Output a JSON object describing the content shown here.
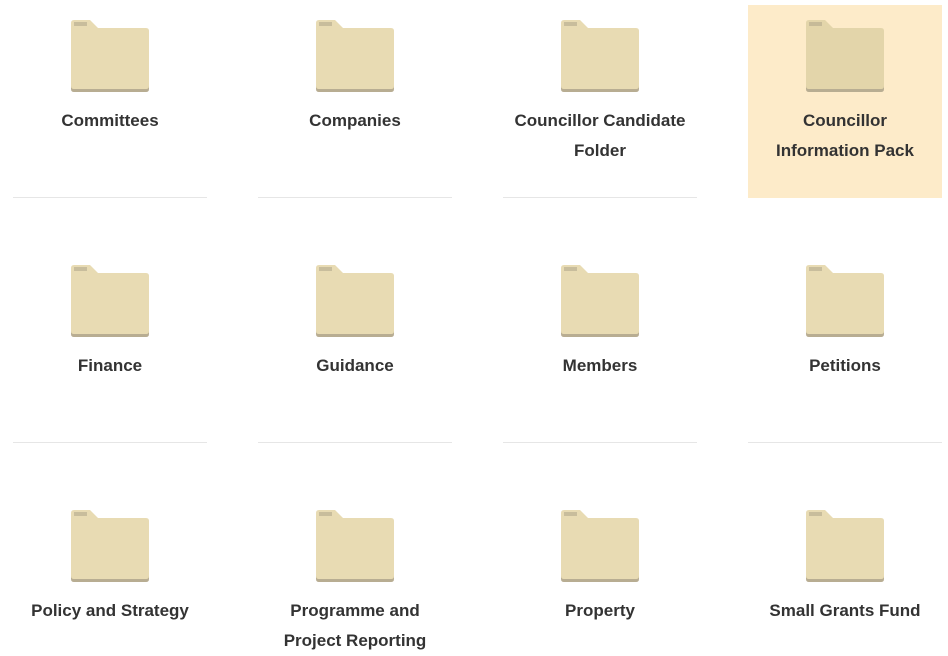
{
  "colors": {
    "folder_fill": "#e8dbb3",
    "folder_tab": "#e3d5aa",
    "folder_shadow": "#b8ad92",
    "highlight_bg": "#fdebc9",
    "label_text": "#333333"
  },
  "folders": [
    {
      "label": "Committees",
      "icon": "folder-icon",
      "highlighted": false
    },
    {
      "label": "Companies",
      "icon": "folder-icon",
      "highlighted": false
    },
    {
      "label": "Councillor Candidate Folder",
      "icon": "folder-icon",
      "highlighted": false
    },
    {
      "label": "Councillor Information Pack",
      "icon": "folder-icon",
      "highlighted": true
    },
    {
      "label": "Finance",
      "icon": "folder-icon",
      "highlighted": false
    },
    {
      "label": "Guidance",
      "icon": "folder-icon",
      "highlighted": false
    },
    {
      "label": "Members",
      "icon": "folder-icon",
      "highlighted": false
    },
    {
      "label": "Petitions",
      "icon": "folder-icon",
      "highlighted": false
    },
    {
      "label": "Policy and Strategy",
      "icon": "folder-icon",
      "highlighted": false
    },
    {
      "label": "Programme and Project Reporting",
      "icon": "folder-icon",
      "highlighted": false
    },
    {
      "label": "Property",
      "icon": "folder-icon",
      "highlighted": false
    },
    {
      "label": "Small Grants Fund",
      "icon": "folder-icon",
      "highlighted": false
    }
  ]
}
